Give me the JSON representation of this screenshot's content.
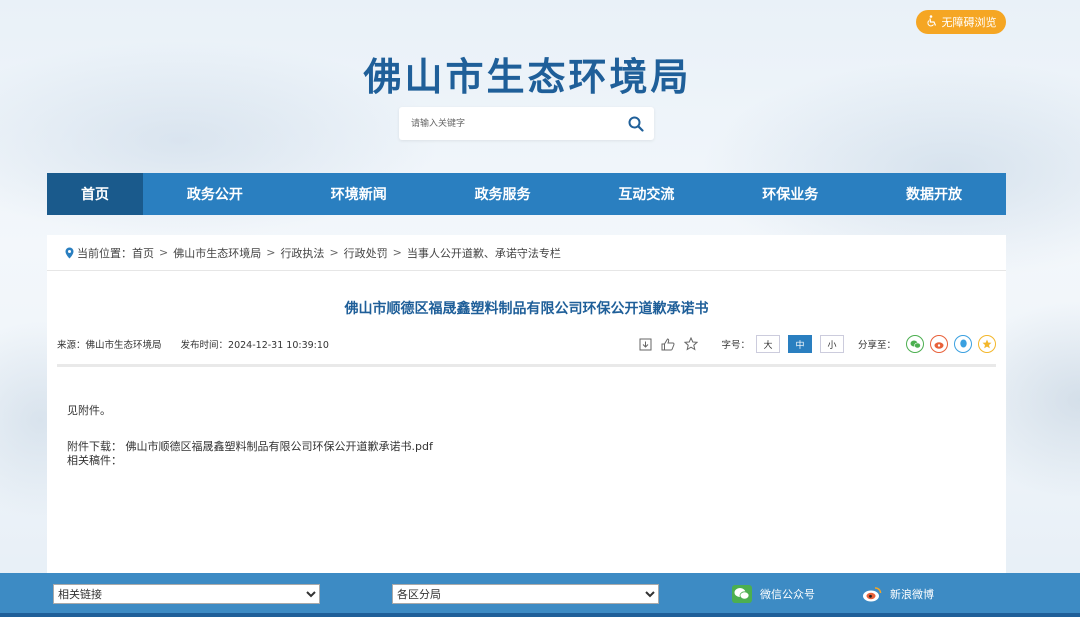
{
  "header": {
    "accessibility_label": "无障碍浏览",
    "site_title": "佛山市生态环境局",
    "search_placeholder": "请输入关键字"
  },
  "nav": {
    "items": [
      {
        "label": "首页"
      },
      {
        "label": "政务公开"
      },
      {
        "label": "环境新闻"
      },
      {
        "label": "政务服务"
      },
      {
        "label": "互动交流"
      },
      {
        "label": "环保业务"
      },
      {
        "label": "数据开放"
      }
    ]
  },
  "breadcrumb": {
    "prefix": "当前位置：",
    "items": [
      "首页",
      "佛山市生态环境局",
      "行政执法",
      "行政处罚",
      "当事人公开道歉、承诺守法专栏"
    ],
    "separator": ">"
  },
  "article": {
    "title": "佛山市顺德区福晟鑫塑料制品有限公司环保公开道歉承诺书",
    "source": "来源：佛山市生态环境局",
    "publish_time": "发布时间：2024-12-31 10:39:10",
    "font_size_label": "字号：",
    "font_sizes": [
      "大",
      "中",
      "小"
    ],
    "share_label": "分享至：",
    "body": "见附件。",
    "attachment_label": "附件下载：",
    "attachment_name": "佛山市顺德区福晟鑫塑料制品有限公司环保公开道歉承诺书.pdf",
    "related_label": "相关稿件："
  },
  "footer": {
    "related_links": "相关链接",
    "districts": "各区分局",
    "wechat": "微信公众号",
    "weibo": "新浪微博"
  },
  "colors": {
    "nav_bg": "#2a7fc0",
    "nav_active": "#1a5a8c",
    "title_blue": "#1f5f99",
    "accessibility_orange": "#f5a623",
    "footer_bg": "#3d8bc4"
  }
}
